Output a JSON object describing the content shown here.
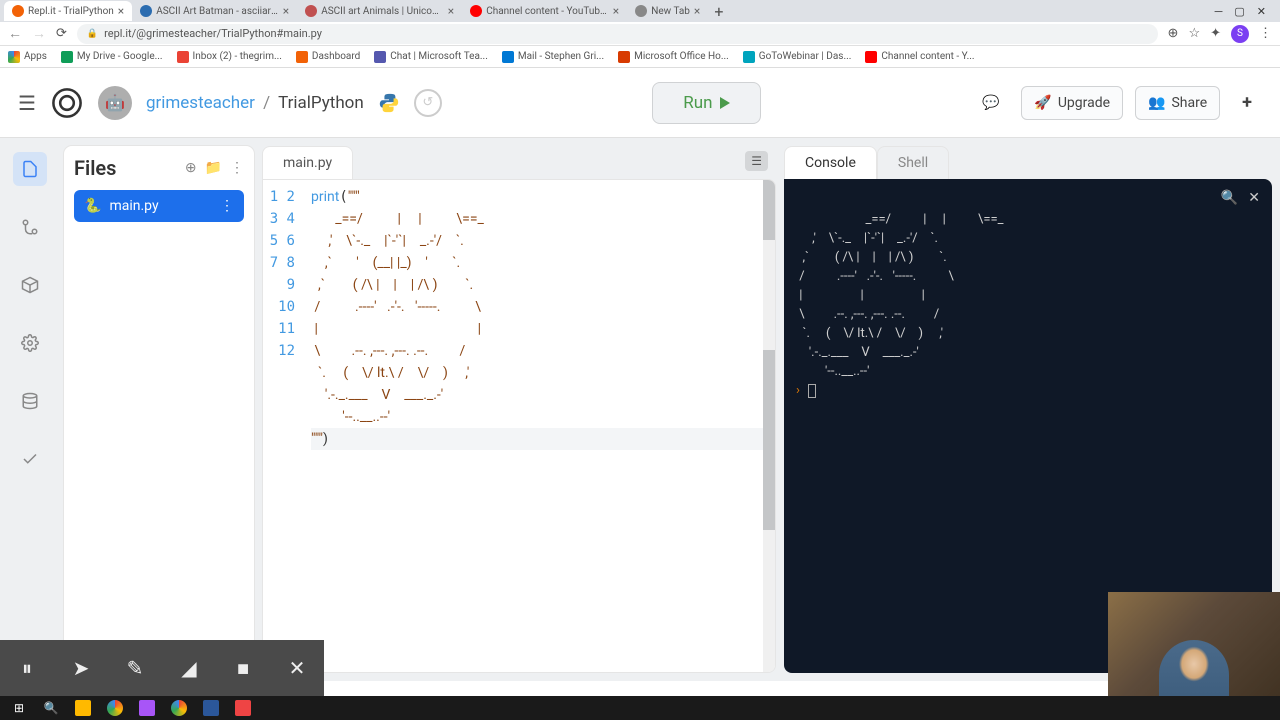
{
  "browser": {
    "tabs": [
      {
        "title": "Repl.it - TrialPython",
        "active": true
      },
      {
        "title": "ASCII Art Batman - asciiart.eu"
      },
      {
        "title": "ASCII art Animals | Unicode Ninj"
      },
      {
        "title": "Channel content - YouTube Stud"
      },
      {
        "title": "New Tab"
      }
    ],
    "url": "repl.it/@grimesteacher/TrialPython#main.py",
    "avatar_letter": "S"
  },
  "bookmarks": [
    {
      "label": "Apps"
    },
    {
      "label": "My Drive - Google..."
    },
    {
      "label": "Inbox (2) - thegrim..."
    },
    {
      "label": "Dashboard"
    },
    {
      "label": "Chat | Microsoft Tea..."
    },
    {
      "label": "Mail - Stephen Gri..."
    },
    {
      "label": "Microsoft Office Ho..."
    },
    {
      "label": "GoToWebinar | Das..."
    },
    {
      "label": "Channel content - Y..."
    }
  ],
  "repl": {
    "user": "grimesteacher",
    "sep": "/",
    "project": "TrialPython",
    "run_label": "Run",
    "upgrade_label": "Upgrade",
    "share_label": "Share"
  },
  "files": {
    "title": "Files",
    "items": [
      {
        "name": "main.py"
      }
    ]
  },
  "editor": {
    "tab": "main.py",
    "line_count": 12,
    "lines": {
      "l1": "print(\"\"\"",
      "l2": "       _==/          |     |          \\==_",
      "l3": "     ,'    \\`-._    |`-'`|    _.-'/    `.",
      "l4": "    ,`       '    (__| |_)    '       `.",
      "l5": "  ,`        ( /\\ |    |    | /\\ )        `.",
      "l6": " /          .----'   .-'-.   '-----.          \\",
      "l7": " |                                              |",
      "l8": " \\         .--. ,---. ,---. .--.         /",
      "l9": "  `.     (    \\/ lt.\\ /    \\/    )     ,'",
      "l10": "    '.-._.___    V    ___._.-'",
      "l11": "         '--..__..--'",
      "l12": "\"\"\")"
    }
  },
  "console": {
    "tab_console": "Console",
    "tab_shell": "Shell",
    "output": "       _==/          |     |          \\==_\n     ,'    \\`-._    |`-'`|    _.-'/    `.\n  ,`        ( /\\ |    |    | /\\ )        `.\n /          .----'   .-'-.   '-----.          \\\n |                  |                  |\n \\         .--. ,---. ,---. .--.         /\n  `.     (    \\/ lt.\\ /    \\/    )     ,'\n    '.-._.___    V    ___._.-'\n         '--..__..--'",
    "prompt": "›"
  }
}
